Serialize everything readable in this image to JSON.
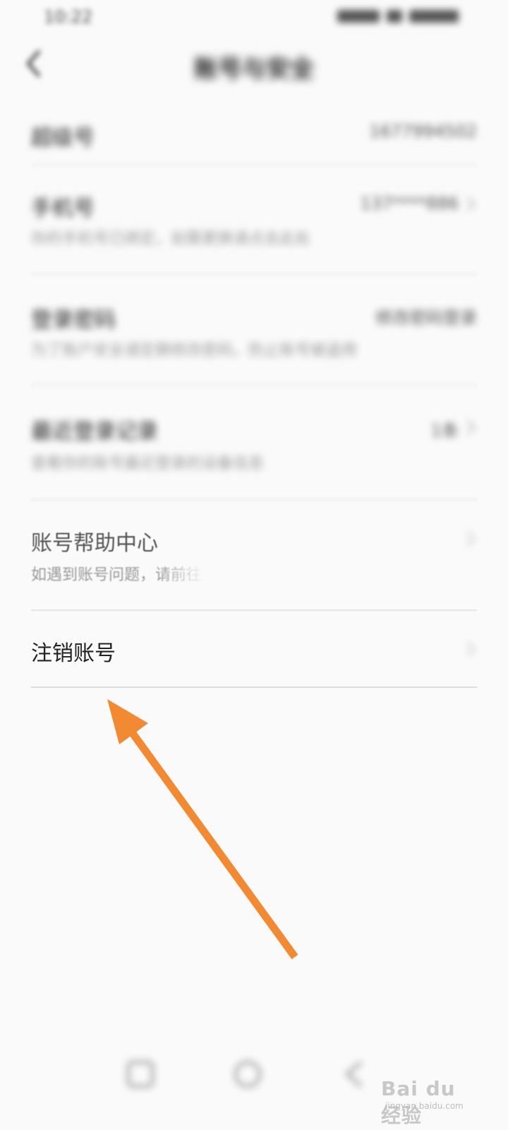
{
  "status_bar": {
    "time": "10:22"
  },
  "header": {
    "title": "账号与安全"
  },
  "rows": [
    {
      "label": "超级号",
      "value": "1677994502",
      "sub": ""
    },
    {
      "label": "手机号",
      "value": "137****886",
      "sub": "你的手机号已绑定，如需更换请点击此处"
    },
    {
      "label": "登录密码",
      "value": "修改密码登录",
      "sub": "为了账户安全请定期修改密码，防止账号被盗用"
    },
    {
      "label": "最近登录记录",
      "value": "1条",
      "sub": "查看你的账号最近登录的设备信息"
    },
    {
      "label": "账号帮助中心",
      "value": "",
      "sub": "如遇到账号问题，请前往寻求帮助"
    },
    {
      "label": "注销账号",
      "value": "",
      "sub": ""
    }
  ],
  "watermark": {
    "logo_text": "Bai du 经验",
    "url": "jingyan.baidu.com"
  },
  "colors": {
    "arrow": "#f28a33",
    "background": "#fafafa"
  }
}
